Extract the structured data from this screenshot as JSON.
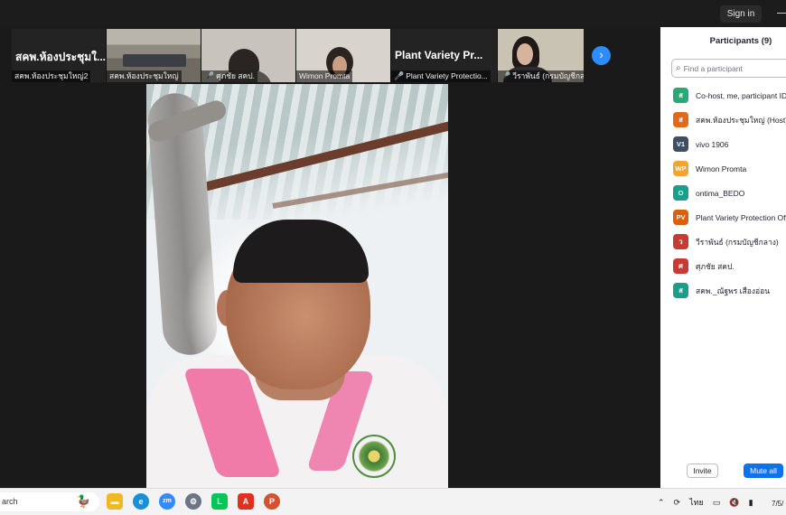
{
  "window": {
    "signin_label": "Sign in",
    "minimize_glyph": "—"
  },
  "strip": {
    "tiles": [
      {
        "kind": "black",
        "big_label": "สคพ.ห้องประชุมใ...",
        "name": "สคพ.ห้องประชุมใหญ่2",
        "muted": false
      },
      {
        "kind": "room",
        "name": "สคพ.ห้องประชุมใหญ่",
        "muted": false
      },
      {
        "kind": "person",
        "name": "ศุภชัย สคป.",
        "muted": true
      },
      {
        "kind": "wimon",
        "name": "Wimon Promta",
        "muted": false
      },
      {
        "kind": "black",
        "big_label": "Plant Variety Pr...",
        "name": "Plant Variety Protectio...",
        "muted": true
      },
      {
        "kind": "woman",
        "name": "วีราพันธ์ (กรมบัญชีกลาง)",
        "muted": true
      }
    ],
    "next_icon": "chevron-right-icon"
  },
  "participants": {
    "title": "Participants (9)",
    "search_placeholder": "Find a participant",
    "items": [
      {
        "initials": "ส",
        "color": "#2aa876",
        "name": "Co-host, me, participant ID:"
      },
      {
        "initials": "ส",
        "color": "#e06a1b",
        "name": "สคพ.ห้องประชุมใหญ่ (Host)"
      },
      {
        "initials": "V1",
        "color": "#3f4f63",
        "name": "vivo 1906"
      },
      {
        "initials": "WP",
        "color": "#f2a62d",
        "name": "Wimon Promta"
      },
      {
        "initials": "O",
        "color": "#1e9e8a",
        "name": "ontima_BEDO"
      },
      {
        "initials": "PV",
        "color": "#d9600f",
        "name": "Plant Variety Protection Off"
      },
      {
        "initials": "ว",
        "color": "#c93a35",
        "name": "วีราพันธ์ (กรมบัญชีกลาง)"
      },
      {
        "initials": "ศ",
        "color": "#c93a35",
        "name": "ศุภชัย สคป."
      },
      {
        "initials": "ส",
        "color": "#1e9e8a",
        "name": "สคพ._ณัฐพร เสืองอ่อน"
      }
    ],
    "invite_label": "Invite",
    "mute_all_label": "Mute all"
  },
  "taskbar": {
    "search_text": "arch",
    "apps": [
      {
        "name": "file-explorer-icon",
        "color": "#f2b824",
        "glyph": "▬"
      },
      {
        "name": "edge-icon",
        "color": "#1a8fd6",
        "glyph": "e"
      },
      {
        "name": "zoom-icon",
        "color": "#2d8cff",
        "glyph": "zm"
      },
      {
        "name": "settings-icon",
        "color": "#6b7585",
        "glyph": "⚙"
      },
      {
        "name": "line-icon",
        "color": "#06c755",
        "glyph": "L"
      },
      {
        "name": "acrobat-icon",
        "color": "#e0301e",
        "glyph": "A"
      },
      {
        "name": "powerpoint-icon",
        "color": "#d35230",
        "glyph": "P"
      }
    ],
    "language": "ไทย",
    "date": "7/5/"
  }
}
